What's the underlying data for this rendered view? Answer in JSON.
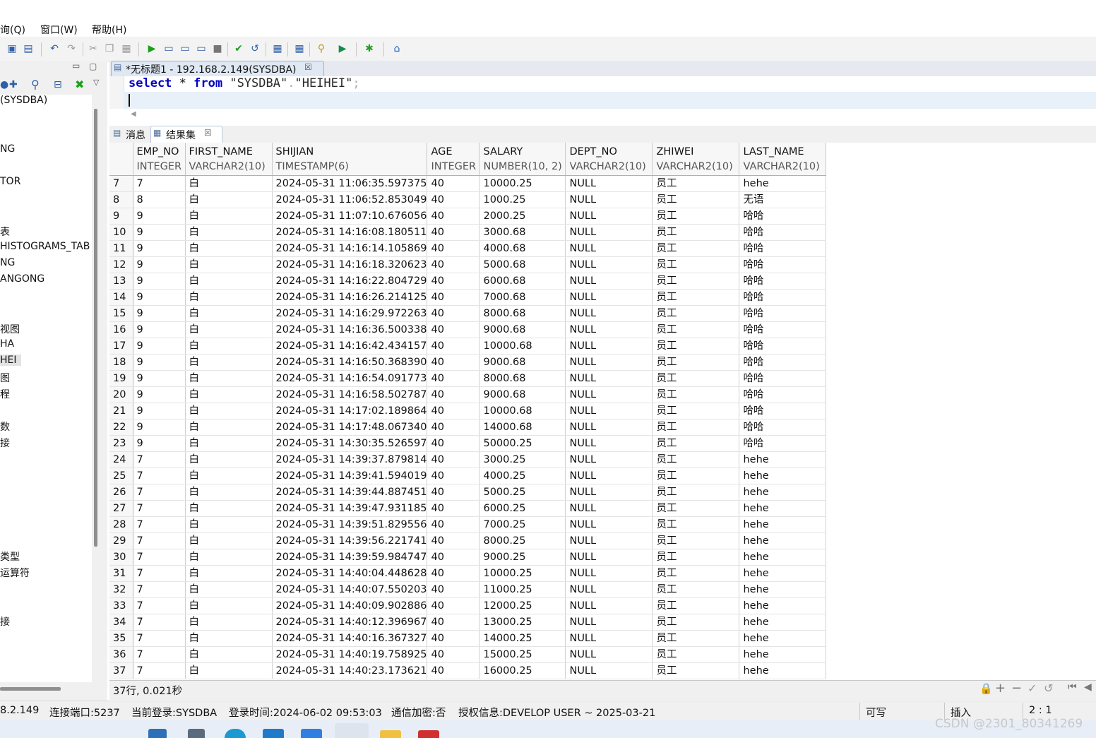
{
  "menu": [
    "询(Q)",
    "窗口(W)",
    "帮助(H)"
  ],
  "tree": {
    "items": [
      "(SYSDBA)",
      "NG",
      "TOR",
      "表",
      "HISTOGRAMS_TAB",
      "NG",
      "ANGONG",
      "视图",
      "HA",
      "HEI",
      "图",
      "程",
      "数",
      "接",
      "类型",
      "运算符",
      "接"
    ],
    "selected_index": 9
  },
  "editor": {
    "tab_title": "*无标题1 - 192.168.2.149(SYSDBA)",
    "sql": {
      "kw1": "select",
      "star": " * ",
      "kw2": "from",
      "schema": " \"SYSDBA\"",
      "dot": ".",
      "table": "\"HEIHEI\"",
      "semi": ";"
    }
  },
  "result_tabs": [
    "消息",
    "结果集"
  ],
  "columns": [
    {
      "name": "EMP_NO",
      "type": "INTEGER"
    },
    {
      "name": "FIRST_NAME",
      "type": "VARCHAR2(10)"
    },
    {
      "name": "SHIJIAN",
      "type": "TIMESTAMP(6)"
    },
    {
      "name": "AGE",
      "type": "INTEGER"
    },
    {
      "name": "SALARY",
      "type": "NUMBER(10, 2)"
    },
    {
      "name": "DEPT_NO",
      "type": "VARCHAR2(10)"
    },
    {
      "name": "ZHIWEI",
      "type": "VARCHAR2(10)"
    },
    {
      "name": "LAST_NAME",
      "type": "VARCHAR2(10)"
    }
  ],
  "rows": [
    [
      "7",
      "7",
      "白",
      "2024-05-31 11:06:35.597375",
      "40",
      "10000.25",
      "NULL",
      "员工",
      "hehe"
    ],
    [
      "8",
      "8",
      "白",
      "2024-05-31 11:06:52.853049",
      "40",
      "1000.25",
      "NULL",
      "员工",
      "无语"
    ],
    [
      "9",
      "9",
      "白",
      "2024-05-31 11:07:10.676056",
      "40",
      "2000.25",
      "NULL",
      "员工",
      "哈哈"
    ],
    [
      "10",
      "9",
      "白",
      "2024-05-31 14:16:08.180511",
      "40",
      "3000.68",
      "NULL",
      "员工",
      "哈哈"
    ],
    [
      "11",
      "9",
      "白",
      "2024-05-31 14:16:14.105869",
      "40",
      "4000.68",
      "NULL",
      "员工",
      "哈哈"
    ],
    [
      "12",
      "9",
      "白",
      "2024-05-31 14:16:18.320623",
      "40",
      "5000.68",
      "NULL",
      "员工",
      "哈哈"
    ],
    [
      "13",
      "9",
      "白",
      "2024-05-31 14:16:22.804729",
      "40",
      "6000.68",
      "NULL",
      "员工",
      "哈哈"
    ],
    [
      "14",
      "9",
      "白",
      "2024-05-31 14:16:26.214125",
      "40",
      "7000.68",
      "NULL",
      "员工",
      "哈哈"
    ],
    [
      "15",
      "9",
      "白",
      "2024-05-31 14:16:29.972263",
      "40",
      "8000.68",
      "NULL",
      "员工",
      "哈哈"
    ],
    [
      "16",
      "9",
      "白",
      "2024-05-31 14:16:36.500338",
      "40",
      "9000.68",
      "NULL",
      "员工",
      "哈哈"
    ],
    [
      "17",
      "9",
      "白",
      "2024-05-31 14:16:42.434157",
      "40",
      "10000.68",
      "NULL",
      "员工",
      "哈哈"
    ],
    [
      "18",
      "9",
      "白",
      "2024-05-31 14:16:50.368390",
      "40",
      "9000.68",
      "NULL",
      "员工",
      "哈哈"
    ],
    [
      "19",
      "9",
      "白",
      "2024-05-31 14:16:54.091773",
      "40",
      "8000.68",
      "NULL",
      "员工",
      "哈哈"
    ],
    [
      "20",
      "9",
      "白",
      "2024-05-31 14:16:58.502787",
      "40",
      "9000.68",
      "NULL",
      "员工",
      "哈哈"
    ],
    [
      "21",
      "9",
      "白",
      "2024-05-31 14:17:02.189864",
      "40",
      "10000.68",
      "NULL",
      "员工",
      "哈哈"
    ],
    [
      "22",
      "9",
      "白",
      "2024-05-31 14:17:48.067340",
      "40",
      "14000.68",
      "NULL",
      "员工",
      "哈哈"
    ],
    [
      "23",
      "9",
      "白",
      "2024-05-31 14:30:35.526597",
      "40",
      "50000.25",
      "NULL",
      "员工",
      "哈哈"
    ],
    [
      "24",
      "7",
      "白",
      "2024-05-31 14:39:37.879814",
      "40",
      "3000.25",
      "NULL",
      "员工",
      "hehe"
    ],
    [
      "25",
      "7",
      "白",
      "2024-05-31 14:39:41.594019",
      "40",
      "4000.25",
      "NULL",
      "员工",
      "hehe"
    ],
    [
      "26",
      "7",
      "白",
      "2024-05-31 14:39:44.887451",
      "40",
      "5000.25",
      "NULL",
      "员工",
      "hehe"
    ],
    [
      "27",
      "7",
      "白",
      "2024-05-31 14:39:47.931185",
      "40",
      "6000.25",
      "NULL",
      "员工",
      "hehe"
    ],
    [
      "28",
      "7",
      "白",
      "2024-05-31 14:39:51.829556",
      "40",
      "7000.25",
      "NULL",
      "员工",
      "hehe"
    ],
    [
      "29",
      "7",
      "白",
      "2024-05-31 14:39:56.221741",
      "40",
      "8000.25",
      "NULL",
      "员工",
      "hehe"
    ],
    [
      "30",
      "7",
      "白",
      "2024-05-31 14:39:59.984747",
      "40",
      "9000.25",
      "NULL",
      "员工",
      "hehe"
    ],
    [
      "31",
      "7",
      "白",
      "2024-05-31 14:40:04.448628",
      "40",
      "10000.25",
      "NULL",
      "员工",
      "hehe"
    ],
    [
      "32",
      "7",
      "白",
      "2024-05-31 14:40:07.550203",
      "40",
      "11000.25",
      "NULL",
      "员工",
      "hehe"
    ],
    [
      "33",
      "7",
      "白",
      "2024-05-31 14:40:09.902886",
      "40",
      "12000.25",
      "NULL",
      "员工",
      "hehe"
    ],
    [
      "34",
      "7",
      "白",
      "2024-05-31 14:40:12.396967",
      "40",
      "13000.25",
      "NULL",
      "员工",
      "hehe"
    ],
    [
      "35",
      "7",
      "白",
      "2024-05-31 14:40:16.367327",
      "40",
      "14000.25",
      "NULL",
      "员工",
      "hehe"
    ],
    [
      "36",
      "7",
      "白",
      "2024-05-31 14:40:19.758925",
      "40",
      "15000.25",
      "NULL",
      "员工",
      "hehe"
    ],
    [
      "37",
      "7",
      "白",
      "2024-05-31 14:40:23.173621",
      "40",
      "16000.25",
      "NULL",
      "员工",
      "hehe"
    ]
  ],
  "grid_status": "37行, 0.021秒",
  "statusbar": {
    "host": "8.2.149",
    "port": "连接端口:5237",
    "user": "当前登录:SYSDBA",
    "login_time": "登录时间:2024-06-02 09:53:03",
    "encrypt": "通信加密:否",
    "license": "授权信息:DEVELOP USER ~ 2025-03-21",
    "mode": "可写",
    "insert": "插入",
    "cursor": "2 : 1"
  },
  "watermark": "CSDN @2301_80341269",
  "colors": {
    "keyword": "#0000c0",
    "string": "#2a2a2a",
    "run": "#1aa01a",
    "home": "#1f5fbf",
    "selected_tree": "#e3e3e3"
  }
}
